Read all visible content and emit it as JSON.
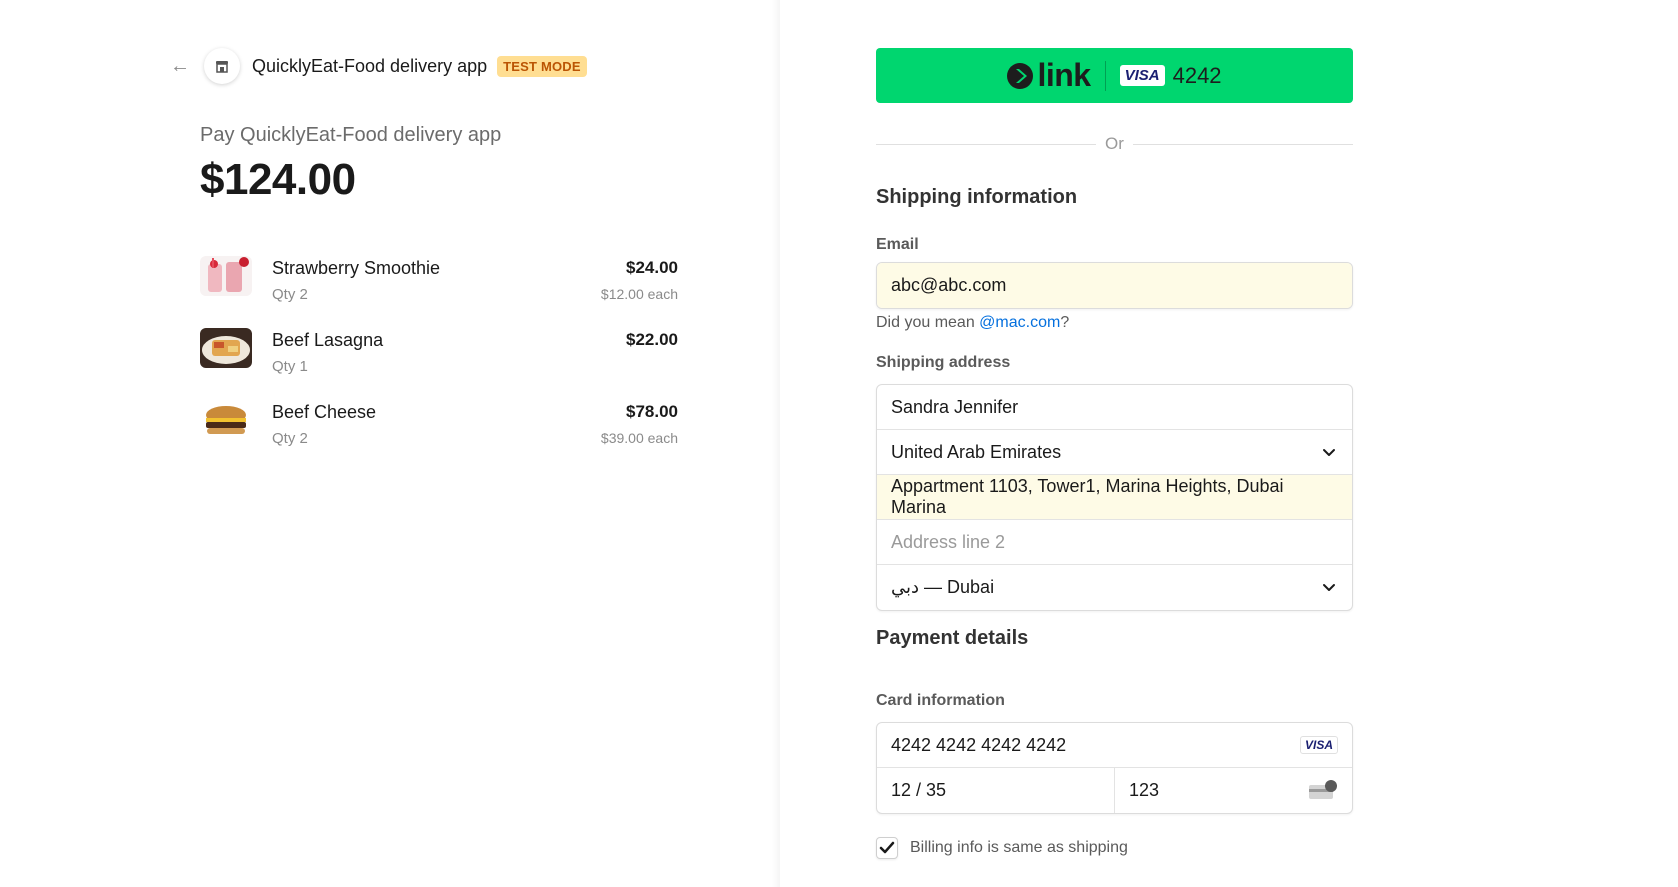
{
  "merchant": {
    "name": "QuicklyEat-Food delivery app",
    "badge": "TEST MODE",
    "pay_label": "Pay QuicklyEat-Food delivery app",
    "total": "$124.00"
  },
  "items": [
    {
      "name": "Strawberry Smoothie",
      "qty": "Qty 2",
      "price": "$24.00",
      "each": "$12.00 each"
    },
    {
      "name": "Beef Lasagna",
      "qty": "Qty 1",
      "price": "$22.00",
      "each": ""
    },
    {
      "name": "Beef Cheese",
      "qty": "Qty 2",
      "price": "$78.00",
      "each": "$39.00 each"
    }
  ],
  "link_button": {
    "word": "link",
    "card_brand": "VISA",
    "last4": "4242"
  },
  "divider_text": "Or",
  "shipping": {
    "title": "Shipping information",
    "email_label": "Email",
    "email_value": "abc@abc.com",
    "did_you_mean_prefix": "Did you mean ",
    "did_you_mean_suggestion": "@mac.com",
    "did_you_mean_suffix": "?",
    "address_label": "Shipping address",
    "name_value": "Sandra Jennifer",
    "country_value": "United Arab Emirates",
    "address1_value": "Appartment 1103, Tower1, Marina Heights, Dubai Marina",
    "address2_placeholder": "Address line 2",
    "emirate_value": "دبي — Dubai"
  },
  "payment": {
    "title": "Payment details",
    "card_label": "Card information",
    "card_number": "4242 4242 4242 4242",
    "card_brand": "VISA",
    "expiry": "12 / 35",
    "cvc": "123",
    "billing_same_label": "Billing info is same as shipping",
    "billing_same_checked": true
  },
  "colors": {
    "link_green": "#00d66f",
    "badge_bg": "#ffde92",
    "badge_text": "#bb5504",
    "autofill_bg": "#fefbe6",
    "link_blue": "#0570de"
  }
}
